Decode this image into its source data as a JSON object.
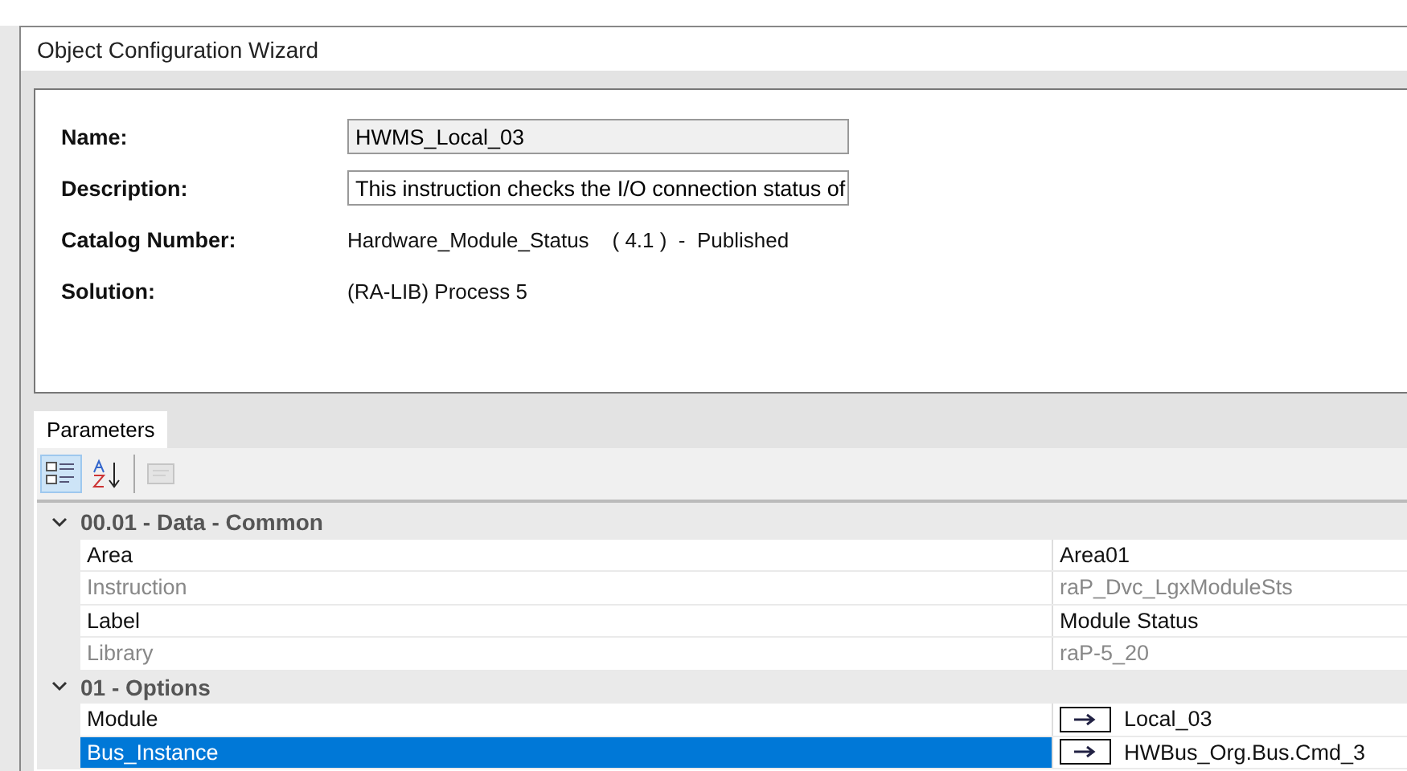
{
  "window": {
    "title": "Object Configuration Wizard"
  },
  "info": [
    {
      "label": "Name:",
      "kind": "field",
      "value": "HWMS_Local_03",
      "readonly": true
    },
    {
      "label": "Description:",
      "kind": "field",
      "value": "This instruction checks the I/O connection status of",
      "readonly": false
    },
    {
      "label": "Catalog Number:",
      "kind": "text",
      "value": "Hardware_Module_Status    ( 4.1 )  -  Published"
    },
    {
      "label": "Solution:",
      "kind": "text",
      "value": "(RA-LIB) Process 5"
    }
  ],
  "tabs": [
    {
      "label": "Parameters",
      "selected": true
    }
  ],
  "toolbar": [
    {
      "kind": "categorized",
      "selected": true
    },
    {
      "kind": "alphabetical",
      "selected": false
    },
    {
      "kind": "property-pages",
      "disabled": true,
      "selected": false
    }
  ],
  "grid": [
    {
      "title": "00.01 - Data - Common",
      "expanded": true,
      "rows": [
        {
          "name": "Area",
          "value": "Area01",
          "disabled": false,
          "selected": false,
          "kind": "text"
        },
        {
          "name": "Instruction",
          "value": "raP_Dvc_LgxModuleSts",
          "disabled": true,
          "selected": false,
          "kind": "text"
        },
        {
          "name": "Label",
          "value": "Module Status",
          "disabled": false,
          "selected": false,
          "kind": "text"
        },
        {
          "name": "Library",
          "value": "raP-5_20",
          "disabled": true,
          "selected": false,
          "kind": "text"
        }
      ]
    },
    {
      "title": "01 - Options",
      "expanded": true,
      "rows": [
        {
          "name": "Module",
          "value": "Local_03",
          "disabled": false,
          "selected": false,
          "kind": "link"
        },
        {
          "name": "Bus_Instance",
          "value": "HWBus_Org.Bus.Cmd_3",
          "disabled": false,
          "selected": true,
          "kind": "link"
        }
      ]
    }
  ]
}
